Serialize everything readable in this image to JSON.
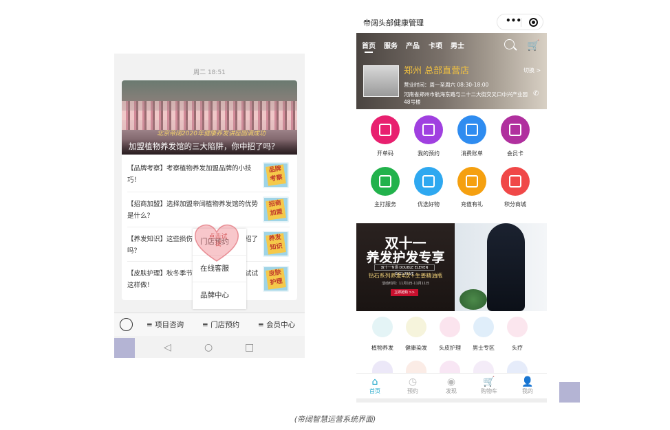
{
  "left": {
    "time": "周二 18:51",
    "banner_sign": "北京帝阔2020年健康养发讲座圆满成功",
    "banner_title": "加盟植物养发馆的三大陷阱，你中招了吗？",
    "articles": [
      {
        "text": "【品牌考察】考察植物养发加盟品牌的小技巧！",
        "thumb": "品牌考察"
      },
      {
        "text": "【招商加盟】选择加盟帝阔植物养发馆的优势是什么？",
        "thumb": "招商加盟"
      },
      {
        "text": "【养发知识】这些损伤头发的习惯，你中招了吗？",
        "thumb": "养发知识"
      },
      {
        "text": "【皮肤护理】秋冬季节皮肤干燥怎么办？试试这样做！",
        "thumb": "皮肤护理"
      }
    ],
    "popup": [
      "门店预约",
      "在线客服",
      "品牌中心"
    ],
    "heart_label": "点击试试",
    "menu": [
      "≡ 项目咨询",
      "≡ 门店预约",
      "≡ 会员中心"
    ],
    "nav": [
      "◁",
      "○",
      "□"
    ]
  },
  "right": {
    "title": "帝阔头部健康管理",
    "capsule_dots": "•••",
    "tabs": [
      "首页",
      "服务",
      "产品",
      "卡项",
      "男士"
    ],
    "cart_icon": "🛒",
    "store_name": "郑州 总部直营店",
    "store_switch": "切换 >",
    "store_hours": "营业时间：周一至周六 08:30-18:00",
    "store_addr": "河南省郑州市航海东路与二十二大街交叉口中兴产业园48号楼",
    "phone_icon": "✆",
    "grid1": [
      {
        "label": "开单码",
        "color": "#e8206f",
        "icon": "qrcode-icon"
      },
      {
        "label": "我的预约",
        "color": "#a040e0",
        "icon": "calendar-icon"
      },
      {
        "label": "消费账单",
        "color": "#2f8cf0",
        "icon": "bill-icon"
      },
      {
        "label": "会员卡",
        "color": "#b0309e",
        "icon": "card-icon"
      }
    ],
    "grid2": [
      {
        "label": "主打服务",
        "color": "#22b24c",
        "icon": "service-icon"
      },
      {
        "label": "优选好物",
        "color": "#2ea8f0",
        "icon": "gift-icon"
      },
      {
        "label": "充值有礼",
        "color": "#f5a010",
        "icon": "star-icon"
      },
      {
        "label": "积分商城",
        "color": "#f04848",
        "icon": "bag-icon"
      }
    ],
    "promo": {
      "t1": "双十一",
      "t2": "养发护发专享",
      "tag": "双十一专场 DOUBLE ELEVEN EXCLUSIVE",
      "t3": "钻石系列养发4次+生姜精油瓶",
      "t4": "活动时间：11月1日-11月11日",
      "btn": "立即抢购 >>"
    },
    "services": [
      {
        "label": "植物养发",
        "color": "#e4f4f6"
      },
      {
        "label": "健康染发",
        "color": "#f6f4dc"
      },
      {
        "label": "头皮护理",
        "color": "#fbe4ee"
      },
      {
        "label": "男士专区",
        "color": "#e0eefa"
      },
      {
        "label": "头疗",
        "color": "#fbe6ee"
      }
    ],
    "tabbar": [
      {
        "label": "首页",
        "icon": "⌂",
        "active": true
      },
      {
        "label": "预约",
        "icon": "◷",
        "active": false
      },
      {
        "label": "发现",
        "icon": "◉",
        "active": false
      },
      {
        "label": "购物车",
        "icon": "🛒",
        "active": false
      },
      {
        "label": "我的",
        "icon": "👤",
        "active": false
      }
    ],
    "accent": "#1aa5c9"
  },
  "caption": "(帝阔智慧运营系统界面)"
}
